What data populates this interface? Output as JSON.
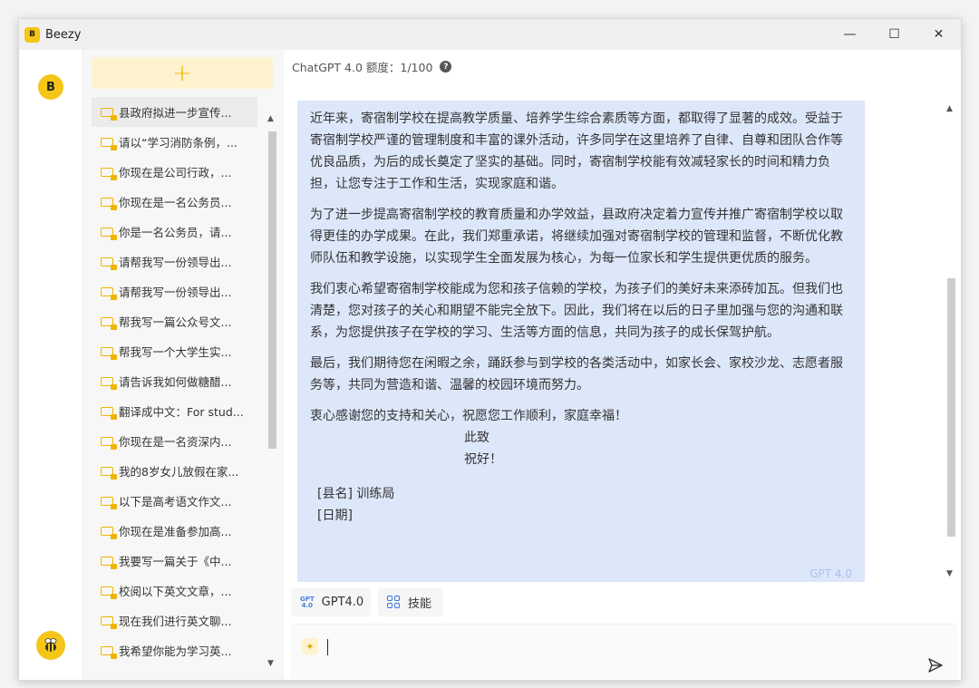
{
  "app": {
    "logo_text": "B",
    "title": "Beezy"
  },
  "window_controls": {
    "minimize": "—",
    "maximize": "☐",
    "close": "✕"
  },
  "sidebar": {
    "new_chat_label": "+",
    "items": [
      {
        "label": "县政府拟进一步宣传..."
      },
      {
        "label": "请以“学习消防条例，..."
      },
      {
        "label": "你现在是公司行政，..."
      },
      {
        "label": "你现在是一名公务员..."
      },
      {
        "label": "你是一名公务员，请..."
      },
      {
        "label": "请帮我写一份领导出..."
      },
      {
        "label": "请帮我写一份领导出..."
      },
      {
        "label": "帮我写一篇公众号文..."
      },
      {
        "label": "帮我写一个大学生实..."
      },
      {
        "label": "请告诉我如何做糖醋..."
      },
      {
        "label": "翻译成中文：For stud..."
      },
      {
        "label": "你现在是一名资深内..."
      },
      {
        "label": "我的8岁女儿放假在家..."
      },
      {
        "label": "以下是高考语文作文..."
      },
      {
        "label": "你现在是准备参加高..."
      },
      {
        "label": "我要写一篇关于《中..."
      },
      {
        "label": "校阅以下英文文章，..."
      },
      {
        "label": "现在我们进行英文聊..."
      },
      {
        "label": "我希望你能为学习英..."
      }
    ]
  },
  "header": {
    "quota_text": "ChatGPT 4.0 额度：1/100",
    "help_icon": "?"
  },
  "message": {
    "paragraphs": [
      "近年来，寄宿制学校在提高教学质量、培养学生综合素质等方面，都取得了显著的成效。受益于寄宿制学校严谨的管理制度和丰富的课外活动，许多同学在这里培养了自律、自尊和团队合作等优良品质，为后的成长奠定了坚实的基础。同时，寄宿制学校能有效减轻家长的时间和精力负担，让您专注于工作和生活，实现家庭和谐。",
      "为了进一步提高寄宿制学校的教育质量和办学效益，县政府决定着力宣传并推广寄宿制学校以取得更佳的办学成果。在此，我们郑重承诺，将继续加强对寄宿制学校的管理和监督，不断优化教师队伍和教学设施，以实现学生全面发展为核心，为每一位家长和学生提供更优质的服务。",
      "我们衷心希望寄宿制学校能成为您和孩子信赖的学校，为孩子们的美好未来添砖加瓦。但我们也清楚，您对孩子的关心和期望不能完全放下。因此，我们将在以后的日子里加强与您的沟通和联系，为您提供孩子在学校的学习、生活等方面的信息，共同为孩子的成长保驾护航。",
      "最后，我们期待您在闲暇之余，踊跃参与到学校的各类活动中，如家长会、家校沙龙、志愿者服务等，共同为营造和谐、温馨的校园环境而努力。",
      "衷心感谢您的支持和关心，祝愿您工作顺利，家庭幸福！"
    ],
    "closing_1": "此致",
    "closing_2": "祝好！",
    "signature_1": "[县名] 训练局",
    "signature_2": "[日期]",
    "model_tag": "GPT 4.0"
  },
  "toolbar": {
    "gpt_chip_icon_top": "GPT",
    "gpt_chip_icon_bottom": "4.0",
    "gpt_chip_label": "GPT4.0",
    "skill_chip_label": "技能"
  },
  "input": {
    "value": ""
  },
  "colors": {
    "accent_yellow": "#f5c518",
    "message_bg": "#dde7fa",
    "link_blue": "#3b73e0"
  }
}
